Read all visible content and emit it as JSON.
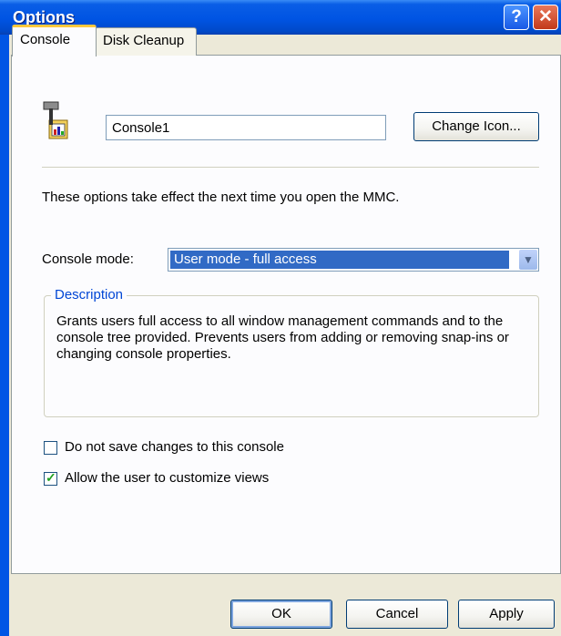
{
  "window": {
    "title": "Options"
  },
  "titlebar": {
    "help_glyph": "?",
    "close_glyph": "✕"
  },
  "tabs": [
    {
      "label": "Console",
      "active": true
    },
    {
      "label": "Disk Cleanup",
      "active": false
    }
  ],
  "console": {
    "icon": "console-hammer-icon",
    "name_value": "Console1",
    "change_icon_label": "Change Icon...",
    "info_text": "These options take effect the next time you open the MMC.",
    "mode_label": "Console mode:",
    "mode_value": "User mode - full access",
    "description_title": "Description",
    "description_text": "Grants users full access to all window management commands and to the console tree provided. Prevents users from adding or removing snap-ins or changing console properties.",
    "no_save_label": "Do not save changes to this console",
    "no_save_checked": false,
    "customize_label": "Allow the user to customize views",
    "customize_checked": true
  },
  "footer": {
    "ok": "OK",
    "cancel": "Cancel",
    "apply": "Apply"
  },
  "colors": {
    "titlebar": "#0054E3",
    "selection": "#316AC5",
    "group_title": "#0046D5",
    "tab_highlight": "#FFC83C"
  }
}
